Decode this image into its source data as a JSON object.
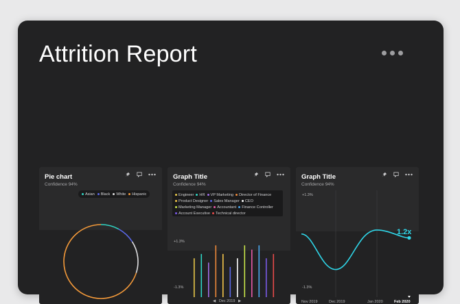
{
  "page": {
    "title": "Attrition Report"
  },
  "cards": {
    "pie": {
      "title": "Pie chart",
      "subtitle": "Confidence 94%",
      "legend": [
        {
          "label": "Asian",
          "color": "#2fd6c5"
        },
        {
          "label": "Black",
          "color": "#5a68e8"
        },
        {
          "label": "White",
          "color": "#e0e0e2"
        },
        {
          "label": "Hispanic",
          "color": "#f49a3a"
        }
      ]
    },
    "bars": {
      "title": "Graph Title",
      "subtitle": "Confidence 94%",
      "legend": [
        {
          "label": "Engineer",
          "color": "#e9c84a"
        },
        {
          "label": "HR",
          "color": "#2fd6c5"
        },
        {
          "label": "VP Marketing",
          "color": "#a06de8"
        },
        {
          "label": "Director of Finance",
          "color": "#f08a3a"
        },
        {
          "label": "Product Designer",
          "color": "#f4c64a"
        },
        {
          "label": "Sales Manager",
          "color": "#5a68e8"
        },
        {
          "label": "CEO",
          "color": "#ffffff"
        },
        {
          "label": "Marketing Manager",
          "color": "#c7e34a"
        },
        {
          "label": "Accountant",
          "color": "#e85aa8"
        },
        {
          "label": "Finance Controller",
          "color": "#4aa8f0"
        },
        {
          "label": "Account Executive",
          "color": "#7a5ae8"
        },
        {
          "label": "Technical director",
          "color": "#e84a4a"
        }
      ],
      "y_top": "+1.3%",
      "y_bottom": "-1.3%",
      "x_label": "Dec 2019"
    },
    "line": {
      "title": "Graph Title",
      "subtitle": "Confidence 94%",
      "y_top": "+1.3%",
      "y_bottom": "-1.3%",
      "x_labels": [
        "Nov 2019",
        "Dec 2019",
        "Jan 2020",
        "Feb 2020"
      ],
      "value_label": "1.2x",
      "line_color": "#2fd6e8"
    }
  },
  "chart_data": [
    {
      "type": "pie",
      "title": "Pie chart",
      "categories": [
        "Asian",
        "Black",
        "White",
        "Hispanic"
      ],
      "values": [
        8,
        8,
        14,
        70
      ],
      "colors": [
        "#2fd6c5",
        "#5a68e8",
        "#e0e0e2",
        "#f49a3a"
      ]
    },
    {
      "type": "bar",
      "title": "Graph Title",
      "categories": [
        "Engineer",
        "HR",
        "VP Marketing",
        "Director of Finance",
        "Product Designer",
        "Sales Manager",
        "CEO",
        "Marketing Manager",
        "Accountant",
        "Finance Controller",
        "Account Executive",
        "Technical director"
      ],
      "values": [
        0.9,
        1.0,
        0.8,
        1.2,
        1.0,
        0.7,
        0.9,
        1.2,
        1.1,
        1.2,
        0.9,
        1.0
      ],
      "colors": [
        "#e9c84a",
        "#2fd6c5",
        "#a06de8",
        "#f08a3a",
        "#f4c64a",
        "#5a68e8",
        "#ffffff",
        "#c7e34a",
        "#e85aa8",
        "#4aa8f0",
        "#7a5ae8",
        "#e84a4a"
      ],
      "ylim": [
        -1.3,
        1.3
      ]
    },
    {
      "type": "line",
      "title": "Graph Title",
      "x": [
        "Nov 2019",
        "Dec 2019",
        "Jan 2020",
        "Feb 2020"
      ],
      "series": [
        {
          "values": [
            0.3,
            -0.6,
            0.4,
            0.2
          ]
        }
      ],
      "ylim": [
        -1.3,
        1.3
      ]
    }
  ]
}
